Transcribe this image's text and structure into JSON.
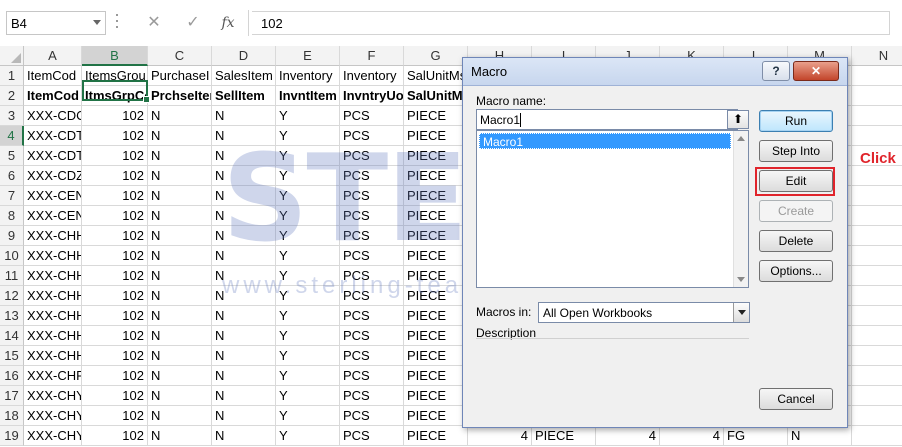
{
  "formula_bar": {
    "name_box": "B4",
    "cancel_icon": "✕",
    "enter_icon": "✓",
    "fx": "fx",
    "value": "102"
  },
  "columns": [
    "A",
    "B",
    "C",
    "D",
    "E",
    "F",
    "G",
    "H",
    "I",
    "J",
    "K",
    "L",
    "M",
    "N"
  ],
  "selected_column": "B",
  "selected_row": "4",
  "rows": [
    {
      "n": "1",
      "cells": [
        "ItemCod",
        "ItemsGrou",
        "PurchaseI",
        "SalesItem",
        "Inventory",
        "Inventory",
        "SalUnitMs",
        "",
        "",
        "",
        "",
        "",
        "",
        ""
      ],
      "bold": false
    },
    {
      "n": "2",
      "cells": [
        "ItemCod",
        "ItmsGrpCo",
        "PrchseIter",
        "SellItem",
        "InvntItem",
        "InvntryUo",
        "SalUnitMs",
        "",
        "",
        "",
        "",
        "",
        "",
        ""
      ],
      "bold": true
    },
    {
      "n": "3",
      "cells": [
        "XXX-CDC",
        "102",
        "N",
        "N",
        "Y",
        "PCS",
        "PIECE",
        "",
        "",
        "",
        "",
        "",
        "",
        ""
      ],
      "bold": false
    },
    {
      "n": "4",
      "cells": [
        "XXX-CDT",
        "102",
        "N",
        "N",
        "Y",
        "PCS",
        "PIECE",
        "",
        "",
        "",
        "",
        "",
        "",
        ""
      ],
      "bold": false
    },
    {
      "n": "5",
      "cells": [
        "XXX-CDT",
        "102",
        "N",
        "N",
        "Y",
        "PCS",
        "PIECE",
        "",
        "",
        "",
        "",
        "",
        "",
        ""
      ],
      "bold": false
    },
    {
      "n": "6",
      "cells": [
        "XXX-CDZ",
        "102",
        "N",
        "N",
        "Y",
        "PCS",
        "PIECE",
        "",
        "",
        "",
        "",
        "",
        "",
        ""
      ],
      "bold": false
    },
    {
      "n": "7",
      "cells": [
        "XXX-CEN",
        "102",
        "N",
        "N",
        "Y",
        "PCS",
        "PIECE",
        "",
        "",
        "",
        "",
        "",
        "",
        ""
      ],
      "bold": false
    },
    {
      "n": "8",
      "cells": [
        "XXX-CEN",
        "102",
        "N",
        "N",
        "Y",
        "PCS",
        "PIECE",
        "",
        "",
        "",
        "",
        "",
        "",
        ""
      ],
      "bold": false
    },
    {
      "n": "9",
      "cells": [
        "XXX-CHH",
        "102",
        "N",
        "N",
        "Y",
        "PCS",
        "PIECE",
        "",
        "",
        "",
        "",
        "",
        "",
        ""
      ],
      "bold": false
    },
    {
      "n": "10",
      "cells": [
        "XXX-CHH",
        "102",
        "N",
        "N",
        "Y",
        "PCS",
        "PIECE",
        "",
        "",
        "",
        "",
        "",
        "",
        ""
      ],
      "bold": false
    },
    {
      "n": "11",
      "cells": [
        "XXX-CHH",
        "102",
        "N",
        "N",
        "Y",
        "PCS",
        "PIECE",
        "",
        "",
        "",
        "",
        "",
        "",
        ""
      ],
      "bold": false
    },
    {
      "n": "12",
      "cells": [
        "XXX-CHH",
        "102",
        "N",
        "N",
        "Y",
        "PCS",
        "PIECE",
        "",
        "",
        "",
        "",
        "",
        "",
        ""
      ],
      "bold": false
    },
    {
      "n": "13",
      "cells": [
        "XXX-CHH",
        "102",
        "N",
        "N",
        "Y",
        "PCS",
        "PIECE",
        "",
        "",
        "",
        "",
        "",
        "",
        ""
      ],
      "bold": false
    },
    {
      "n": "14",
      "cells": [
        "XXX-CHH",
        "102",
        "N",
        "N",
        "Y",
        "PCS",
        "PIECE",
        "",
        "",
        "",
        "",
        "",
        "",
        ""
      ],
      "bold": false
    },
    {
      "n": "15",
      "cells": [
        "XXX-CHH",
        "102",
        "N",
        "N",
        "Y",
        "PCS",
        "PIECE",
        "",
        "",
        "",
        "",
        "",
        "",
        ""
      ],
      "bold": false
    },
    {
      "n": "16",
      "cells": [
        "XXX-CHR",
        "102",
        "N",
        "N",
        "Y",
        "PCS",
        "PIECE",
        "",
        "",
        "",
        "",
        "",
        "",
        ""
      ],
      "bold": false
    },
    {
      "n": "17",
      "cells": [
        "XXX-CHY",
        "102",
        "N",
        "N",
        "Y",
        "PCS",
        "PIECE",
        "",
        "",
        "",
        "",
        "",
        "",
        ""
      ],
      "bold": false
    },
    {
      "n": "18",
      "cells": [
        "XXX-CHY",
        "102",
        "N",
        "N",
        "Y",
        "PCS",
        "PIECE",
        "",
        "",
        "",
        "",
        "",
        "",
        ""
      ],
      "bold": false
    },
    {
      "n": "19",
      "cells": [
        "XXX-CHY",
        "102",
        "N",
        "N",
        "Y",
        "PCS",
        "PIECE",
        "4",
        "PIECE",
        "4",
        "4",
        "FG",
        "N",
        ""
      ],
      "bold": false
    }
  ],
  "watermark": {
    "logo": "STEM",
    "registered": "®",
    "url": "www.sterling-team.com"
  },
  "dialog": {
    "title": "Macro",
    "help_label": "?",
    "close_label": "✕",
    "macro_name_label": "Macro name:",
    "macro_name_value": "Macro1",
    "up_arrow": "⬆",
    "macros": [
      "Macro1"
    ],
    "macros_in_label": "Macros in:",
    "macros_in_value": "All Open Workbooks",
    "description_label": "Description",
    "buttons": {
      "run": "Run",
      "step_into": "Step Into",
      "edit": "Edit",
      "create": "Create",
      "delete": "Delete",
      "options": "Options...",
      "cancel": "Cancel"
    }
  },
  "annotation": {
    "click_label": "Click",
    "color": "#e0242b"
  },
  "colors": {
    "excel_green": "#217346",
    "selection_blue": "#3399ff"
  }
}
